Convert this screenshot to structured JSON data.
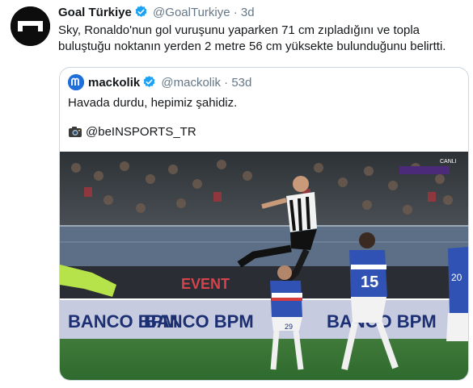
{
  "tweet": {
    "author_name": "Goal Türkiye",
    "handle": "@GoalTurkiye",
    "separator": "·",
    "time": "3d",
    "text": "Sky, Ronaldo'nun gol vuruşunu yaparken 71 cm zıpladığını ve topla buluştuğu noktanın yerden 2 metre 56 cm yüksekte bulunduğunu belirtti."
  },
  "quoted": {
    "author_name": "mackolik",
    "handle": "@mackolik",
    "separator": "·",
    "time": "53d",
    "text": "Havada durdu, hepimiz şahidiz.",
    "credit": "@beINSPORTS_TR"
  },
  "photo": {
    "broadcast_badge": "CANLI",
    "boards": [
      "EVENT",
      "BANCO BPM",
      "BANCO BPM",
      "BANCO BPM"
    ],
    "player_numbers": [
      "15",
      "29",
      "20"
    ]
  },
  "colors": {
    "verified": "#1da1f2",
    "muted": "#657786",
    "border": "#ccd6dd",
    "mackolik_brand": "#1e6fd9"
  },
  "icons": [
    "verified-badge-icon",
    "camera-icon",
    "goal-logo-icon",
    "mackolik-logo-icon"
  ]
}
